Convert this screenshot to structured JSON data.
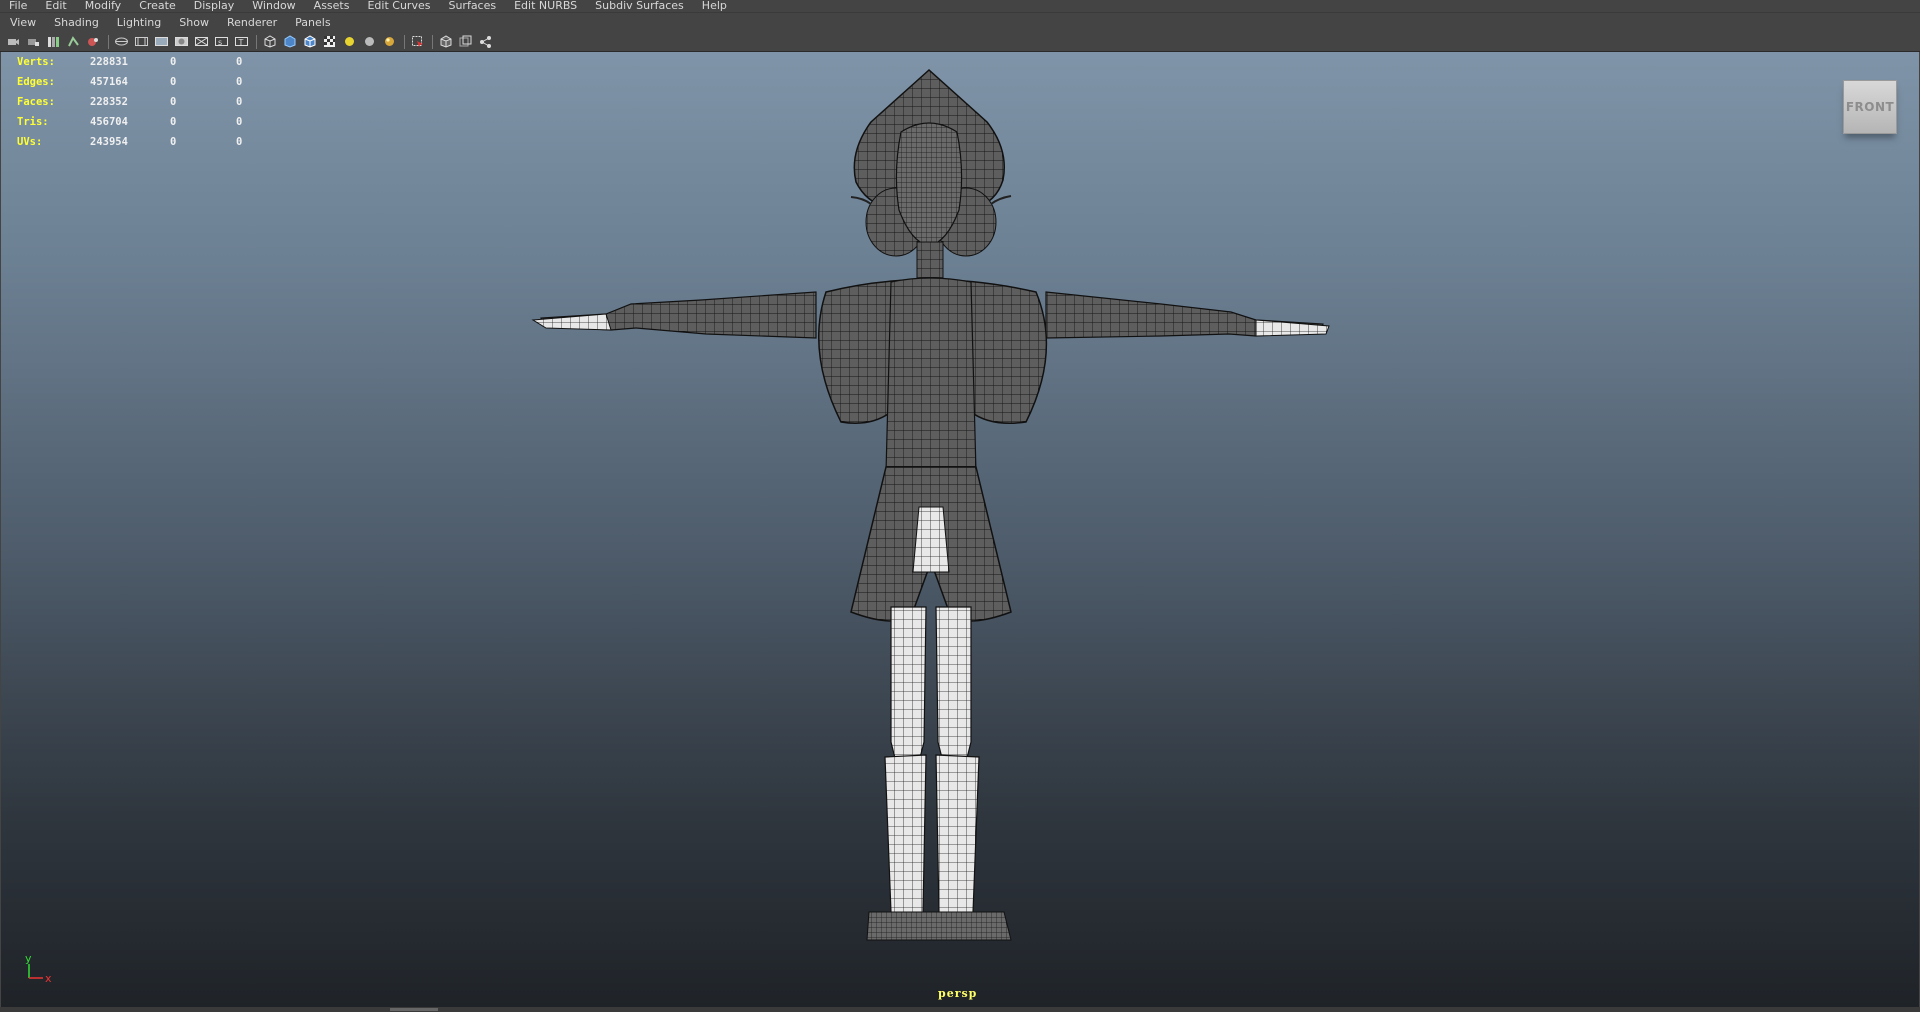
{
  "menubar": {
    "items": [
      "File",
      "Edit",
      "Modify",
      "Create",
      "Display",
      "Window",
      "Assets",
      "Edit Curves",
      "Surfaces",
      "Edit NURBS",
      "Subdiv Surfaces",
      "Help"
    ]
  },
  "panel_menu": {
    "items": [
      "View",
      "Shading",
      "Lighting",
      "Show",
      "Renderer",
      "Panels"
    ]
  },
  "toolbar": {
    "icons": [
      "select-camera-icon",
      "lock-camera-icon",
      "bookmark-icon",
      "image-plane-icon",
      "2d-pan-icon",
      "grease-pencil-icon",
      "grid-icon",
      "film-gate-icon",
      "resolution-gate-icon",
      "gate-mask-icon",
      "field-chart-icon",
      "safe-action-icon",
      "safe-title-icon",
      "wireframe-icon",
      "smooth-shade-icon",
      "wireframe-on-shaded-icon",
      "textured-icon",
      "default-light-icon",
      "all-lights-icon",
      "shadows-icon",
      "xray-joints-icon",
      "isolate-select-icon",
      "camera-view-icon",
      "layout-icon",
      "share-icon"
    ]
  },
  "hud": {
    "rows": [
      {
        "label": "Verts:",
        "v1": "228831",
        "v2": "0",
        "v3": "0"
      },
      {
        "label": "Edges:",
        "v1": "457164",
        "v2": "0",
        "v3": "0"
      },
      {
        "label": "Faces:",
        "v1": "228352",
        "v2": "0",
        "v3": "0"
      },
      {
        "label": "Tris:",
        "v1": "456704",
        "v2": "0",
        "v3": "0"
      },
      {
        "label": "UVs:",
        "v1": "243954",
        "v2": "0",
        "v3": "0"
      }
    ]
  },
  "viewcube": {
    "label": "FRONT"
  },
  "camera": {
    "label": "persp"
  },
  "axis": {
    "y": "y",
    "x": "x"
  },
  "colors": {
    "hud_label": "#ffff33",
    "axis_y": "#33dd33",
    "axis_x": "#ee3333",
    "camera_label": "#ffff66"
  }
}
